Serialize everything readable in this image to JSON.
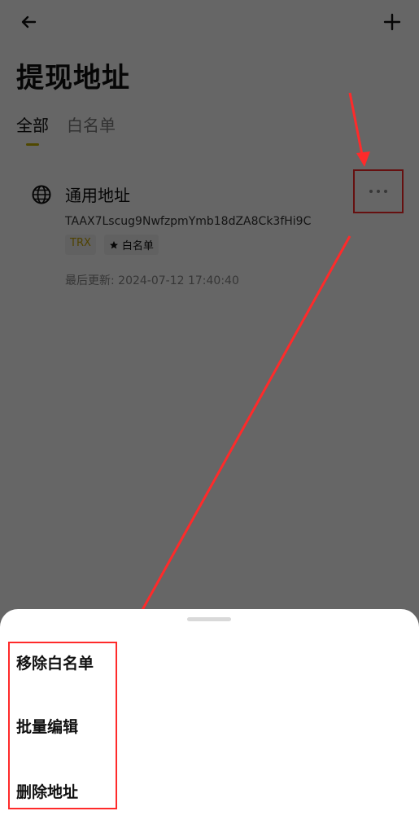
{
  "header": {
    "back_icon": "arrow-left-icon",
    "add_icon": "plus-icon",
    "title": "提现地址"
  },
  "tabs": [
    {
      "label": "全部",
      "active": true
    },
    {
      "label": "白名单",
      "active": false
    }
  ],
  "address_card": {
    "icon": "globe-icon",
    "name": "通用地址",
    "address": "TAAX7Lscug9NwfzpmYmb18dZA8Ck3fHi9C",
    "network_badge": "TRX",
    "whitelist_badge": "白名单",
    "updated": "最后更新: 2024-07-12 17:40:40",
    "more_icon": "more-horizontal-icon"
  },
  "bottom_sheet": {
    "items": [
      {
        "label": "移除白名单"
      },
      {
        "label": "批量编辑"
      },
      {
        "label": "删除地址"
      }
    ]
  },
  "colors": {
    "accent": "#c8b400",
    "highlight": "#ff2a2a",
    "overlay": "rgba(0,0,0,0.6)"
  }
}
